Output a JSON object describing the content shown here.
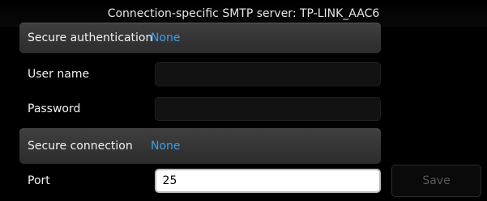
{
  "header": {
    "title": "Connection-specific SMTP server: TP-LINK_AAC6"
  },
  "form": {
    "secure_auth_label": "Secure authentication",
    "secure_auth_value": "None",
    "username_label": "User name",
    "username_value": "",
    "password_label": "Password",
    "password_value": "",
    "secure_conn_label": "Secure connection",
    "secure_conn_value": "None",
    "port_label": "Port",
    "port_value": "25"
  },
  "actions": {
    "save_label": "Save"
  },
  "colors": {
    "accent": "#3ea0e6",
    "background": "#000000",
    "header_row": "#363636"
  }
}
